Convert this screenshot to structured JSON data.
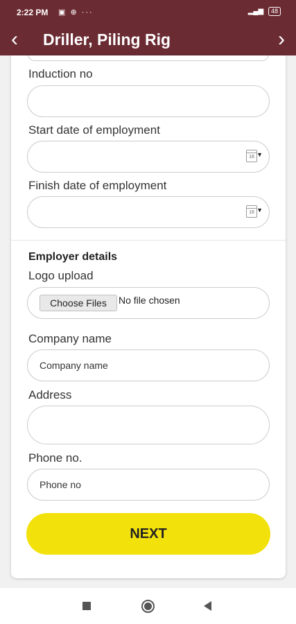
{
  "status_bar": {
    "time": "2:22 PM",
    "icons": "▣ ⊕ ···",
    "signal": "▂▄▆",
    "battery": "48"
  },
  "header": {
    "title": "Driller, Piling Rig",
    "back_icon": "‹",
    "forward_icon": "›"
  },
  "form": {
    "induction_label": "Induction no",
    "start_date_label": "Start date of employment",
    "finish_date_label": "Finish date of employment",
    "calendar_day": "16",
    "caret": "▼",
    "employer_section_title": "Employer details",
    "logo_label": "Logo upload",
    "choose_files_label": "Choose Files",
    "file_status": "No file chosen",
    "company_label": "Company name",
    "company_placeholder": "Company name",
    "address_label": "Address",
    "phone_label": "Phone no.",
    "phone_placeholder": "Phone no"
  },
  "actions": {
    "next_label": "NEXT"
  },
  "colors": {
    "header": "#6b2b33",
    "next_button": "#f2e10a"
  }
}
